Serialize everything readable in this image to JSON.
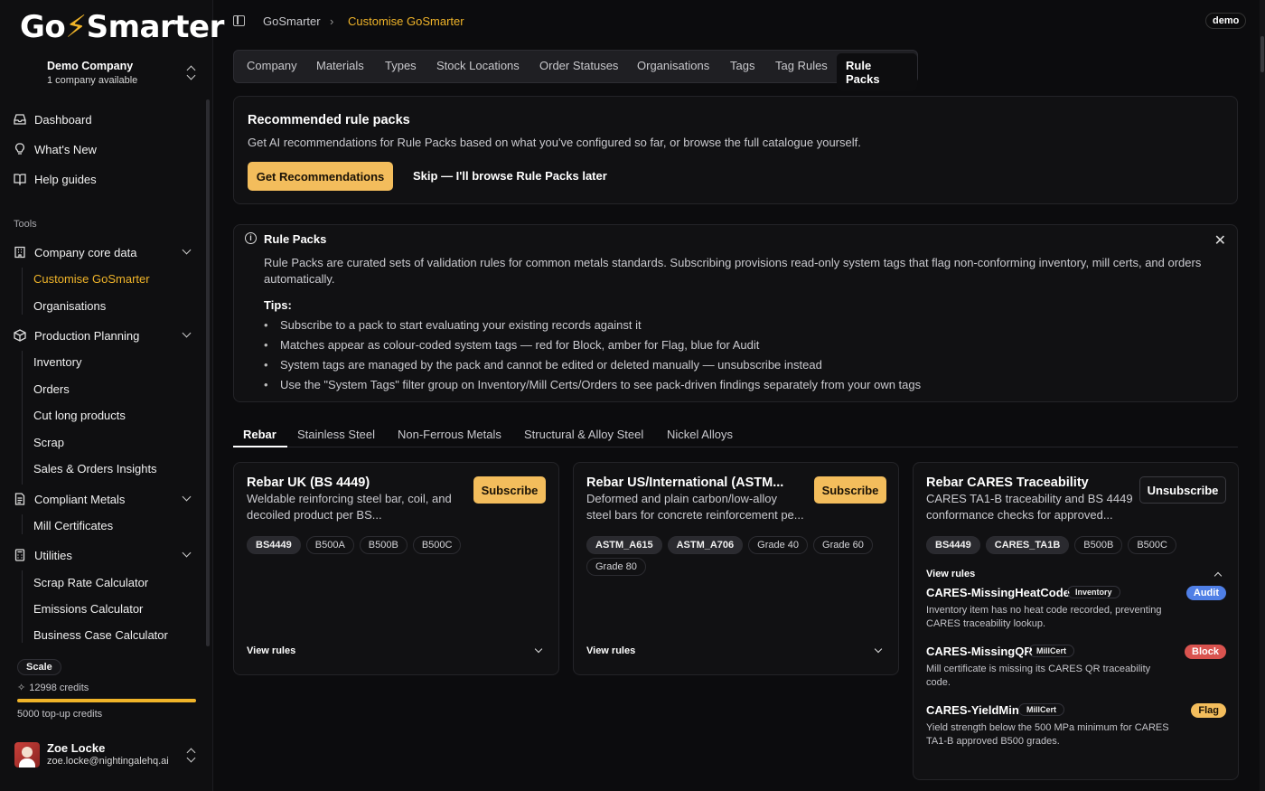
{
  "app": {
    "logo_left": "Go",
    "logo_mid": "⚡",
    "logo_right": "Smarter",
    "accent": "#f0b429",
    "mode_badge": "demo"
  },
  "company": {
    "name": "Demo Company",
    "sub": "1 company available"
  },
  "sidebar": {
    "top_items": [
      {
        "label": "Dashboard",
        "icon": "inbox-icon"
      },
      {
        "label": "What's New",
        "icon": "lightbulb-icon"
      },
      {
        "label": "Help guides",
        "icon": "book-icon"
      }
    ],
    "tools_label": "Tools",
    "groups": [
      {
        "label": "Company core data",
        "icon": "building-icon",
        "items": [
          "Customise GoSmarter",
          "Organisations"
        ]
      },
      {
        "label": "Production Planning",
        "icon": "package-icon",
        "items": [
          "Inventory",
          "Orders",
          "Cut long products",
          "Scrap",
          "Sales & Orders Insights"
        ]
      },
      {
        "label": "Compliant Metals",
        "icon": "document-icon",
        "items": [
          "Mill Certificates"
        ]
      },
      {
        "label": "Utilities",
        "icon": "calculator-icon",
        "items": [
          "Scrap Rate Calculator",
          "Emissions Calculator",
          "Business Case Calculator"
        ]
      }
    ]
  },
  "plan": {
    "badge": "Scale",
    "credits": "12998 credits",
    "topup": "5000 top-up credits",
    "usage_fraction": 1.0
  },
  "user": {
    "name": "Zoe Locke",
    "email": "zoe.locke@nightingalehq.ai"
  },
  "breadcrumb": {
    "root": "GoSmarter",
    "separator": "›",
    "current": "Customise GoSmarter"
  },
  "settings_tabs": [
    "Company",
    "Materials",
    "Types",
    "Stock Locations",
    "Order Statuses",
    "Organisations",
    "Tags",
    "Tag Rules",
    "Rule Packs"
  ],
  "recommend": {
    "title": "Recommended rule packs",
    "desc": "Get AI recommendations for Rule Packs based on what you've configured so far, or browse the full catalogue yourself.",
    "primary": "Get Recommendations",
    "skip": "Skip — I'll browse Rule Packs later"
  },
  "info": {
    "title": "Rule Packs",
    "text": "Rule Packs are curated sets of validation rules for common metals standards. Subscribing provisions read-only system tags that flag non-conforming inventory, mill certs, and orders automatically.",
    "tips_title": "Tips:",
    "tips": [
      "Subscribe to a pack to start evaluating your existing records against it",
      "Matches appear as colour-coded system tags — red for Block, amber for Flag, blue for Audit",
      "System tags are managed by the pack and cannot be edited or deleted manually — unsubscribe instead",
      "Use the \"System Tags\" filter group on Inventory/Mill Certs/Orders to see pack-driven findings separately from your own tags"
    ]
  },
  "category_tabs": [
    "Rebar",
    "Stainless Steel",
    "Non-Ferrous Metals",
    "Structural & Alloy Steel",
    "Nickel Alloys"
  ],
  "packs": [
    {
      "title": "Rebar UK (BS 4449)",
      "desc1": "Weldable reinforcing steel bar, coil, and",
      "desc2": "decoiled product per BS...",
      "action": "Subscribe",
      "chips": [
        {
          "label": "BS4449",
          "sys": true
        },
        {
          "label": "B500A",
          "sys": false
        },
        {
          "label": "B500B",
          "sys": false
        },
        {
          "label": "B500C",
          "sys": false
        }
      ],
      "view_rules": "View rules"
    },
    {
      "title": "Rebar US/International (ASTM...",
      "desc1": "Deformed and plain carbon/low-alloy",
      "desc2": "steel bars for concrete reinforcement pe...",
      "action": "Subscribe",
      "chips": [
        {
          "label": "ASTM_A615",
          "sys": true
        },
        {
          "label": "ASTM_A706",
          "sys": true
        },
        {
          "label": "Grade 40",
          "sys": false
        },
        {
          "label": "Grade 60",
          "sys": false
        },
        {
          "label": "Grade 80",
          "sys": false
        }
      ],
      "view_rules": "View rules"
    },
    {
      "title": "Rebar CARES Traceability",
      "desc1": "CARES TA1-B traceability and BS 4449",
      "desc2": "conformance checks for approved...",
      "action": "Unsubscribe",
      "chips": [
        {
          "label": "BS4449",
          "sys": true
        },
        {
          "label": "CARES_TA1B",
          "sys": true
        },
        {
          "label": "B500B",
          "sys": false
        },
        {
          "label": "B500C",
          "sys": false
        }
      ],
      "view_rules": "View rules",
      "rules": [
        {
          "name": "CARES-MissingHeatCode",
          "tag": "Inventory",
          "severity": "Audit",
          "desc": "Inventory item has no heat code recorded, preventing CARES traceability lookup."
        },
        {
          "name": "CARES-MissingQR",
          "tag": "MillCert",
          "severity": "Block",
          "desc": "Mill certificate is missing its CARES QR traceability code."
        },
        {
          "name": "CARES-YieldMin",
          "tag": "MillCert",
          "severity": "Flag",
          "desc": "Yield strength below the 500 MPa minimum for CARES TA1-B approved B500 grades."
        }
      ]
    }
  ]
}
